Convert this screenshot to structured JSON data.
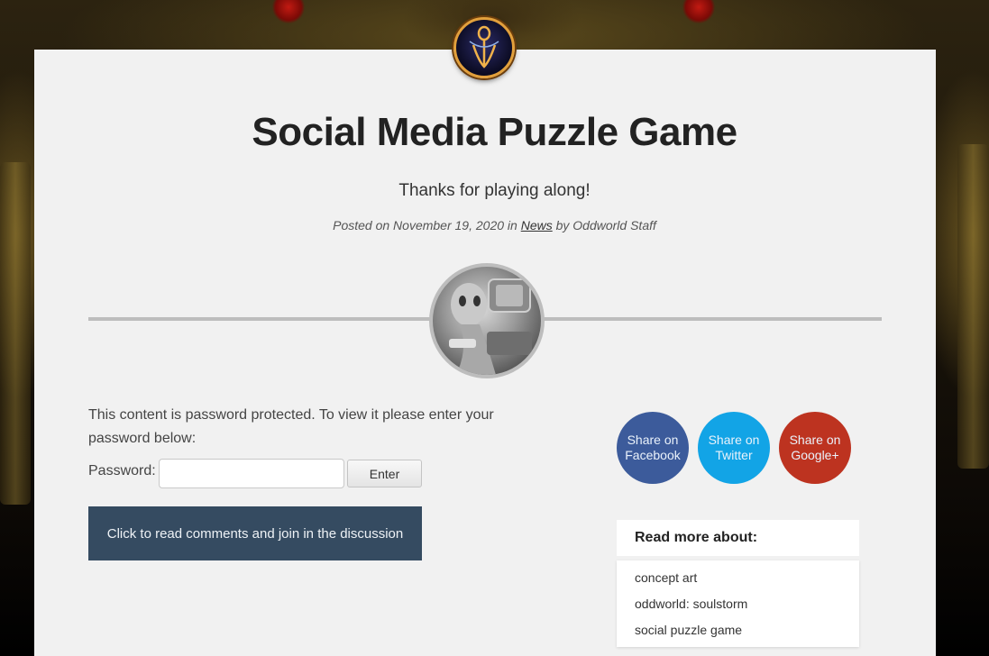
{
  "post": {
    "title": "Social Media Puzzle Game",
    "subtitle": "Thanks for playing along!",
    "meta_prefix": "Posted on November 19, 2020 in",
    "category": "News",
    "meta_suffix": "by Oddworld Staff"
  },
  "password_form": {
    "notice": "This content is password protected. To view it please enter your password below:",
    "label": "Password:",
    "value": "",
    "submit_label": "Enter"
  },
  "comments_button": "Click to read comments and join in the discussion",
  "share": {
    "facebook": {
      "line1": "Share on",
      "line2": "Facebook",
      "color": "#3c5b9b"
    },
    "twitter": {
      "line1": "Share on",
      "line2": "Twitter",
      "color": "#12a4e6"
    },
    "google": {
      "line1": "Share on",
      "line2": "Google+",
      "color": "#bd3320"
    }
  },
  "read_more": {
    "heading": "Read more about:",
    "tags": [
      "concept art",
      "oddworld: soulstorm",
      "social puzzle game"
    ]
  },
  "colors": {
    "accent_dark": "#354b61",
    "card_bg": "#f1f1f1",
    "logo_ring": "#e2a03c"
  }
}
